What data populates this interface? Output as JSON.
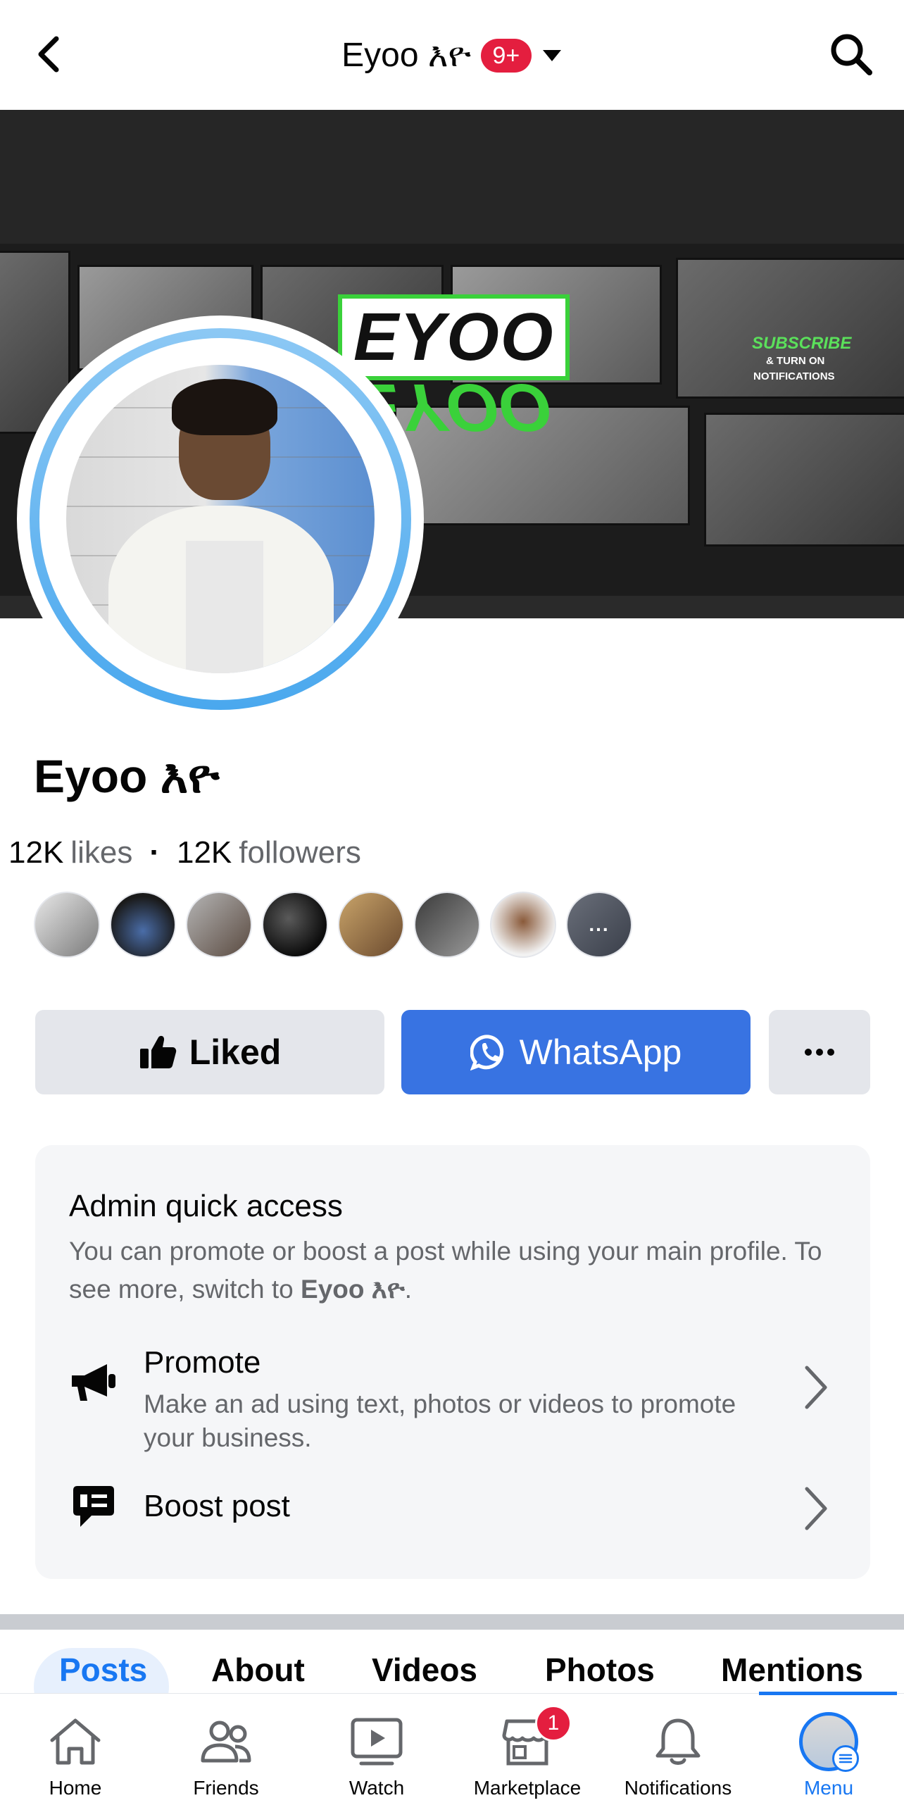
{
  "header": {
    "title": "Eyoo እዮ",
    "notification_count": "9+"
  },
  "cover": {
    "brand_text": "EYOO",
    "subscribe": "SUBSCRIBE",
    "turn_on": "& TURN ON",
    "notifications": "NOTIFICATIONS"
  },
  "profile": {
    "name": "Eyoo እዮ",
    "likes_count": "12K",
    "likes_label": "likes",
    "followers_count": "12K",
    "followers_label": "followers",
    "friend_more": "..."
  },
  "actions": {
    "liked_label": "Liked",
    "whatsapp_label": "WhatsApp"
  },
  "admin": {
    "title": "Admin quick access",
    "desc_prefix": "You can promote or boost a post while using your main profile. To see more, switch to ",
    "desc_name": "Eyoo እዮ",
    "desc_suffix": ".",
    "promote_title": "Promote",
    "promote_sub": "Make an ad using text, photos or videos to promote your business.",
    "boost_title": "Boost post"
  },
  "tabs": [
    "Posts",
    "About",
    "Videos",
    "Photos",
    "Mentions"
  ],
  "bottom_nav": {
    "home": "Home",
    "friends": "Friends",
    "watch": "Watch",
    "marketplace": "Marketplace",
    "marketplace_badge": "1",
    "notifications": "Notifications",
    "menu": "Menu"
  },
  "colors": {
    "accent": "#1877f2",
    "whatsapp_button": "#3873e2",
    "badge_red": "#e41e3f",
    "brand_green": "#3ad13a"
  }
}
